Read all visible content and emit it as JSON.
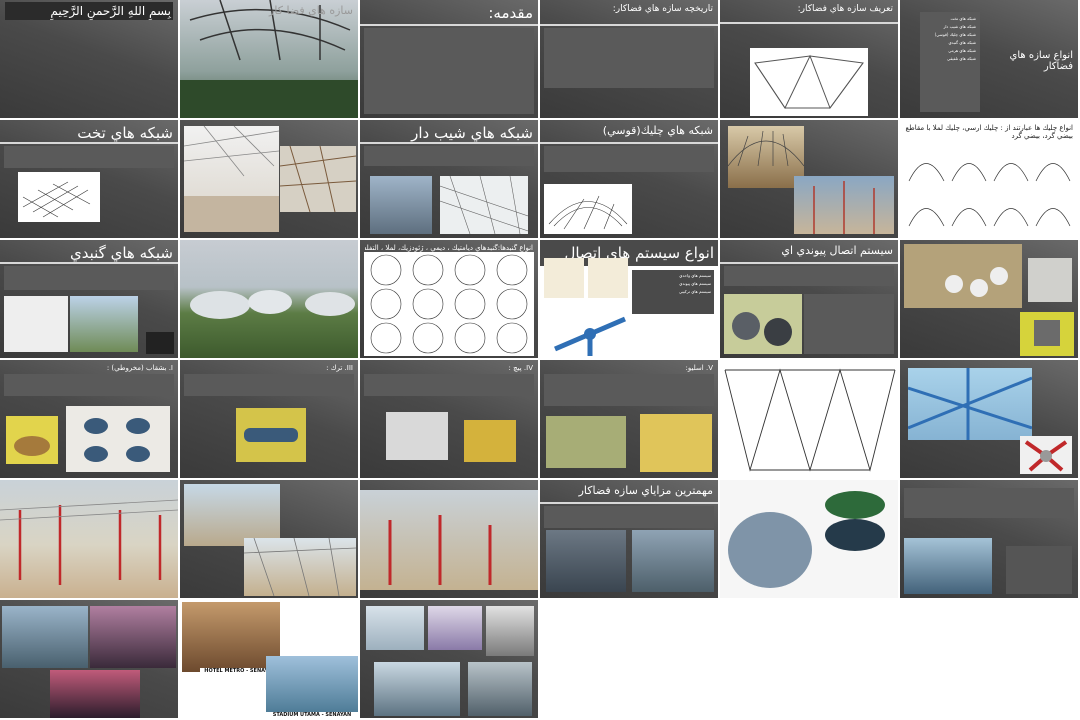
{
  "slides": [
    {
      "title": "بِسمِ اللهِ الرَّحمنِ الرَّحِيمِ"
    },
    {
      "title": "سازه هاي فضا كار"
    },
    {
      "title": "مقدمه:"
    },
    {
      "title": "تاريخچه سازه هاي فضاكار:"
    },
    {
      "title": "تعريف سازه هاي فضاكار:"
    },
    {
      "title": "انواع سازه هاي فضاكار",
      "items": [
        "شبكه هاي تخت",
        "شبكه هاي شيب دار",
        "شبكه هاي چليك (قوسي)",
        "شبكه هاي گنبدي",
        "شبكه هاي هرمي",
        "شبكه هاي تلفيقي"
      ]
    },
    {
      "title": "شبكه هاي تخت"
    },
    {
      "title": ""
    },
    {
      "title": "شبكه هاي شيب دار"
    },
    {
      "title": "شبكه هاي چليك(قوسي)"
    },
    {
      "title": ""
    },
    {
      "title": "انواع چليك ها عبارتند از : چليك ارسي، چليك لملا با مقاطع بيضي گرد، بيضي گرد"
    },
    {
      "title": "شبكه هاي گنبدي"
    },
    {
      "title": ""
    },
    {
      "title": "انواع گنبدها:گنبدهاي ديامتيك ، ديمي ، ژئودزيك، لملا ، التفلش ، شده اي"
    },
    {
      "title": "انواع سيستم هاي اتصال",
      "items": [
        "سيستم هاي واحدي",
        "سيستم هاي پيوندي",
        "سيستم هاي تركيبي"
      ]
    },
    {
      "title": "سيستم اتصال پيوندي اي"
    },
    {
      "title": ""
    },
    {
      "title": "I. بشقاب (مخروطي) :"
    },
    {
      "title": "III. ترك :"
    },
    {
      "title": "IV. پيچ :"
    },
    {
      "title": "V. اسليو:"
    },
    {
      "title": ""
    },
    {
      "title": ""
    },
    {
      "title": ""
    },
    {
      "title": ""
    },
    {
      "title": ""
    },
    {
      "title": "مهمترين مزاياي سازه فضاكار"
    },
    {
      "title": ""
    },
    {
      "title": ""
    },
    {
      "title": ""
    },
    {
      "title": "",
      "captions": [
        "HOTEL METRO - SENAYAN",
        "STADIUM UTAMA - SENAYAN"
      ]
    },
    {
      "title": ""
    }
  ],
  "colors": {
    "slide_bg": "#4a4a4a",
    "separator": "#d8d8d8",
    "blue_frame": "#2f6fb5",
    "red_column": "#c0282a"
  }
}
